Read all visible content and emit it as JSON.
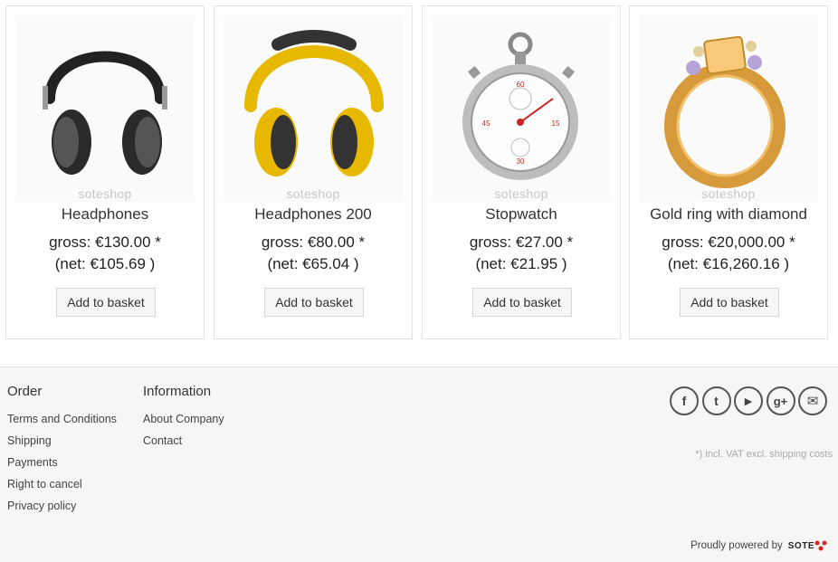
{
  "products": [
    {
      "name": "Headphones",
      "gross": "gross: €130.00 *",
      "net": "(net: €105.69 )",
      "button": "Add to basket",
      "watermark": "soteshop",
      "image": "black-headphones"
    },
    {
      "name": "Headphones 200",
      "gross": "gross: €80.00 *",
      "net": "(net: €65.04 )",
      "button": "Add to basket",
      "watermark": "soteshop",
      "image": "yellow-headphones"
    },
    {
      "name": "Stopwatch",
      "gross": "gross: €27.00 *",
      "net": "(net: €21.95 )",
      "button": "Add to basket",
      "watermark": "soteshop",
      "image": "stopwatch"
    },
    {
      "name": "Gold ring with diamond",
      "gross": "gross: €20,000.00 *",
      "net": "(net: €16,260.16 )",
      "button": "Add to basket",
      "watermark": "soteshop",
      "image": "gold-ring"
    }
  ],
  "footer": {
    "order": {
      "title": "Order",
      "links": [
        "Terms and Conditions",
        "Shipping",
        "Payments",
        "Right to cancel",
        "Privacy policy"
      ]
    },
    "information": {
      "title": "Information",
      "links": [
        "About Company",
        "Contact"
      ]
    },
    "social": [
      {
        "icon": "facebook-icon",
        "glyph": "f"
      },
      {
        "icon": "twitter-icon",
        "glyph": "t"
      },
      {
        "icon": "youtube-icon",
        "glyph": "▶"
      },
      {
        "icon": "google-plus-icon",
        "glyph": "g+"
      },
      {
        "icon": "mail-icon",
        "glyph": "✉"
      }
    ],
    "vat_note": "*) incl. VAT excl. shipping costs",
    "powered_by": "Proudly powered by",
    "brand": "SOTE"
  }
}
